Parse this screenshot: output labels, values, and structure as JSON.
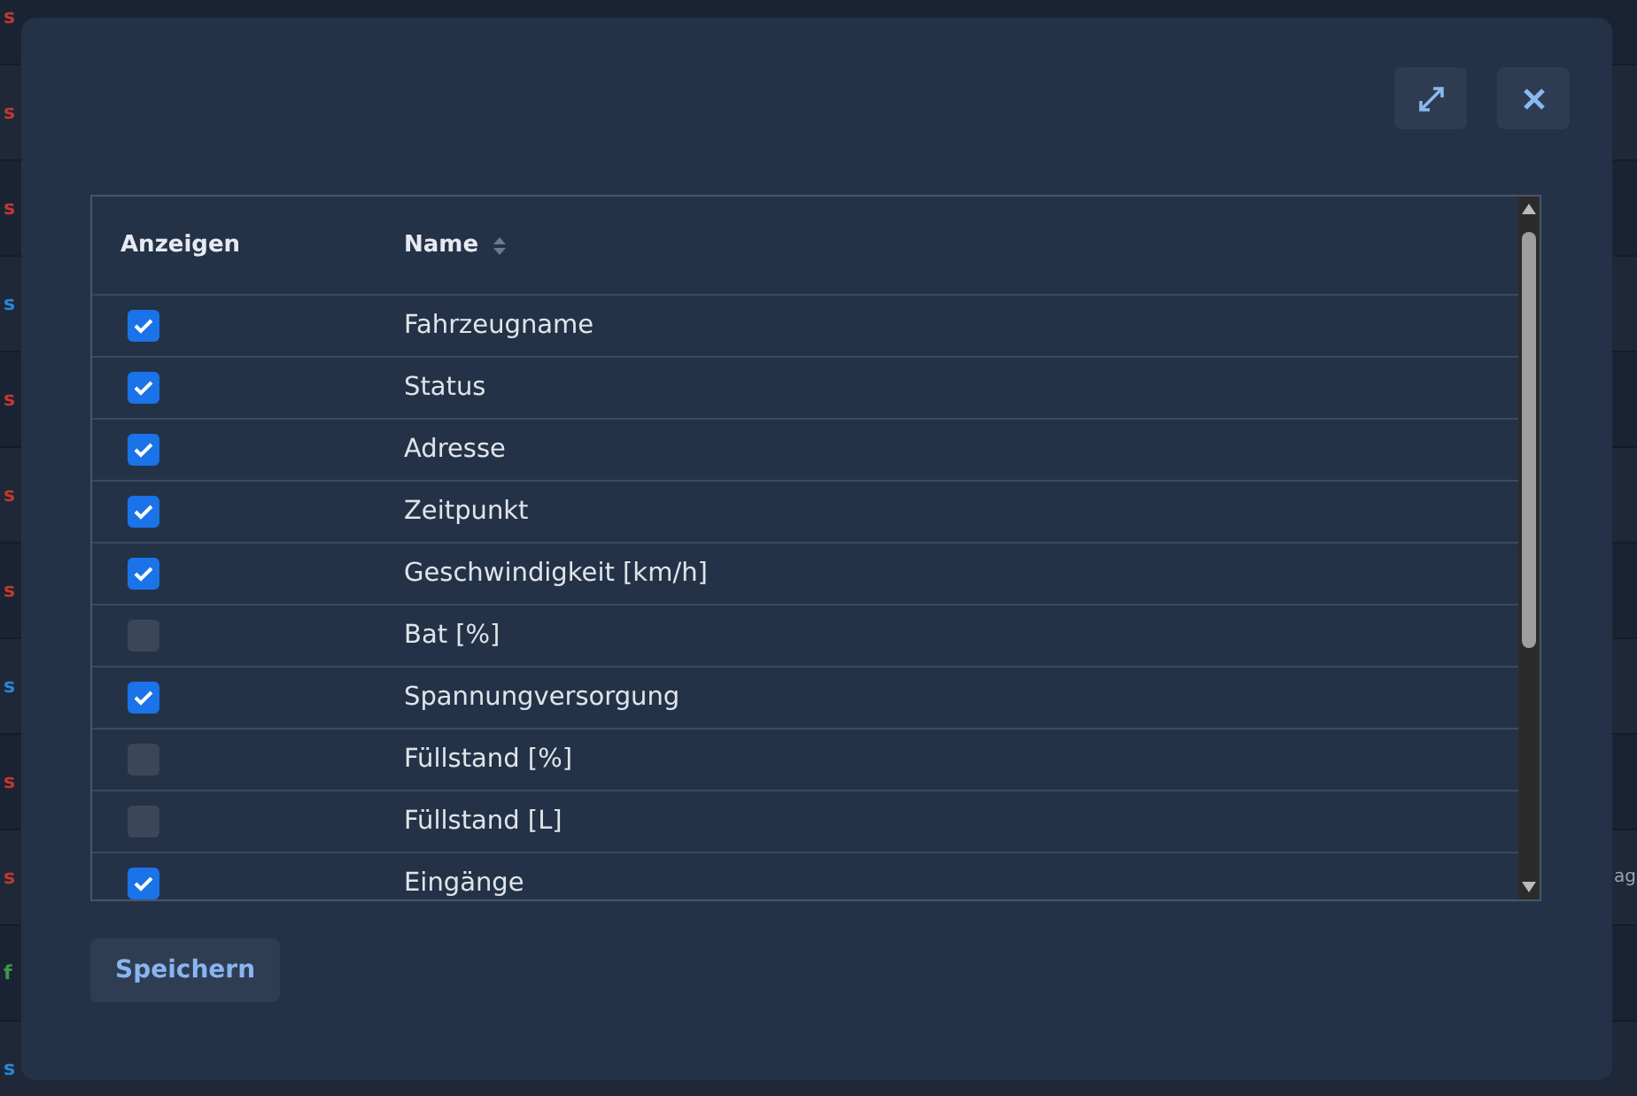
{
  "background_table": {
    "rows": [
      {
        "status": "s",
        "color": "#c0392f"
      },
      {
        "status": "s",
        "color": "#c0392f"
      },
      {
        "status": "s",
        "color": "#c0392f"
      },
      {
        "status": "s",
        "color": "#2a86d6"
      },
      {
        "status": "s",
        "color": "#c0392f"
      },
      {
        "status": "s",
        "color": "#c0392f"
      },
      {
        "status": "s",
        "color": "#c0392f"
      },
      {
        "status": "s",
        "color": "#2a86d6"
      },
      {
        "status": "s",
        "color": "#c0392f"
      },
      {
        "status": "s",
        "color": "#c0392f",
        "column_4": "ag"
      },
      {
        "status": "f",
        "color": "#3b9a4b"
      },
      {
        "status": "s",
        "color": "#2a86d6"
      }
    ]
  },
  "dialog": {
    "table": {
      "columns": [
        {
          "label": "Anzeigen",
          "sortable": false
        },
        {
          "label": "Name",
          "sortable": true
        }
      ],
      "rows": [
        {
          "name": "Fahrzeugname",
          "checked": true
        },
        {
          "name": "Status",
          "checked": true
        },
        {
          "name": "Adresse",
          "checked": true
        },
        {
          "name": "Zeitpunkt",
          "checked": true
        },
        {
          "name": "Geschwindigkeit [km/h]",
          "checked": true
        },
        {
          "name": "Bat [%]",
          "checked": false
        },
        {
          "name": "Spannungversorgung",
          "checked": true
        },
        {
          "name": "Füllstand [%]",
          "checked": false
        },
        {
          "name": "Füllstand [L]",
          "checked": false
        },
        {
          "name": "Eingänge",
          "checked": true
        }
      ]
    },
    "buttons": [
      {
        "label": "Speichern"
      }
    ]
  }
}
